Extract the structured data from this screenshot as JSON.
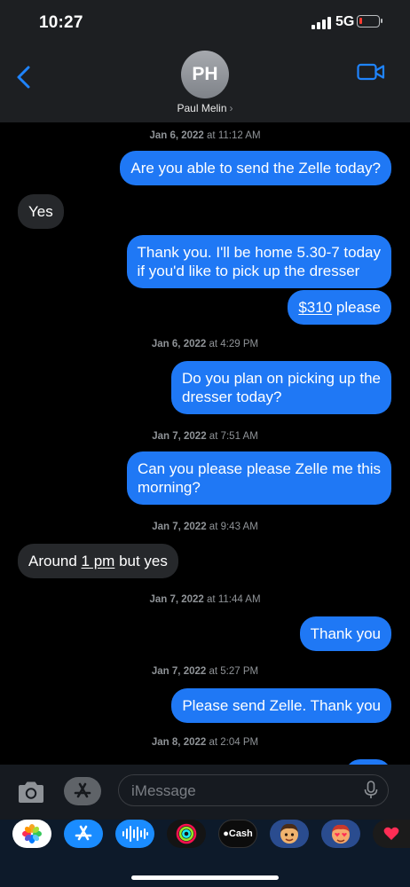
{
  "status_bar": {
    "time": "10:27",
    "network": "5G"
  },
  "contact": {
    "initials": "PH",
    "name": "Paul Melin"
  },
  "messages": [
    {
      "timestamp_date": "Jan 6, 2022",
      "timestamp_time": "at 11:12 AM"
    },
    {
      "text": "Are you able to send the Zelle today?"
    },
    {
      "text": "Yes"
    },
    {
      "line1": "Thank you.  I'll be home 5.30-7 today",
      "line2": "if you'd like to pick up the dresser"
    },
    {
      "amount": "$310",
      "text": " please"
    },
    {
      "timestamp_date": "Jan 6, 2022",
      "timestamp_time": "at 4:29 PM"
    },
    {
      "line1": "Do you plan on picking up the",
      "line2": "dresser today?"
    },
    {
      "timestamp_date": "Jan 7, 2022",
      "timestamp_time": "at 7:51 AM"
    },
    {
      "line1": "Can you please please Zelle me this",
      "line2": "morning?"
    },
    {
      "timestamp_date": "Jan 7, 2022",
      "timestamp_time": "at 9:43 AM"
    },
    {
      "prefix": "Around ",
      "time": "1 pm",
      "suffix": " but yes"
    },
    {
      "timestamp_date": "Jan 7, 2022",
      "timestamp_time": "at 11:44 AM"
    },
    {
      "text": "Thank you"
    },
    {
      "timestamp_date": "Jan 7, 2022",
      "timestamp_time": "at 5:27 PM"
    },
    {
      "text": "Please send Zelle. Thank you"
    },
    {
      "timestamp_date": "Jan 8, 2022",
      "timestamp_time": "at 2:04 PM"
    }
  ],
  "composer": {
    "placeholder": "iMessage"
  },
  "app_tray": {
    "cash_label": "Cash"
  },
  "colors": {
    "outgoing_bubble": "#1f78f5",
    "incoming_bubble": "#26282b",
    "accent": "#1f84ff"
  }
}
